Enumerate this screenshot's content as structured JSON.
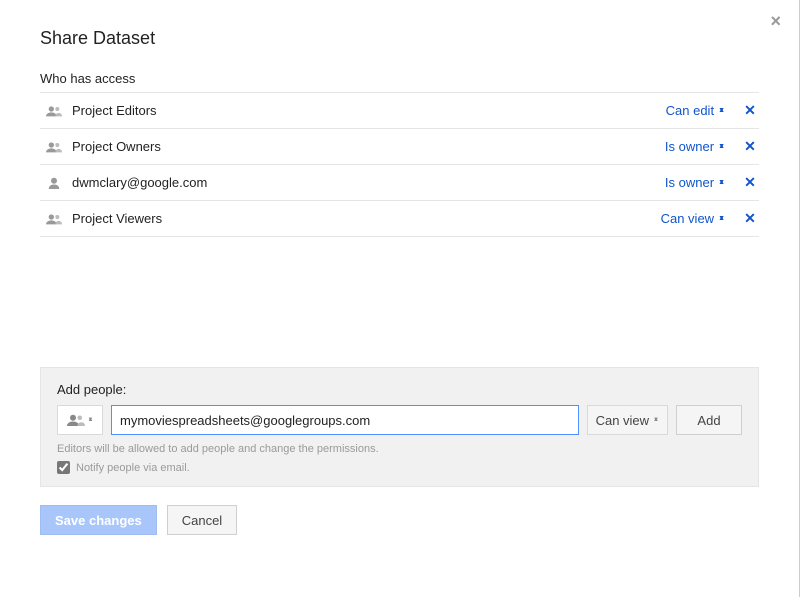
{
  "dialog": {
    "title": "Share Dataset",
    "who_has_access_label": "Who has access"
  },
  "access_rows": [
    {
      "icon": "group",
      "name": "Project Editors",
      "permission": "Can edit"
    },
    {
      "icon": "group",
      "name": "Project Owners",
      "permission": "Is owner"
    },
    {
      "icon": "person",
      "name": "dwmclary@google.com",
      "permission": "Is owner"
    },
    {
      "icon": "group",
      "name": "Project Viewers",
      "permission": "Can view"
    }
  ],
  "add_people": {
    "label": "Add people:",
    "input_value": "mymoviespreadsheets@googlegroups.com",
    "permission": "Can view",
    "add_button": "Add",
    "helper": "Editors will be allowed to add people and change the permissions.",
    "notify_label": "Notify people via email.",
    "notify_checked": true
  },
  "footer": {
    "save": "Save changes",
    "cancel": "Cancel"
  }
}
